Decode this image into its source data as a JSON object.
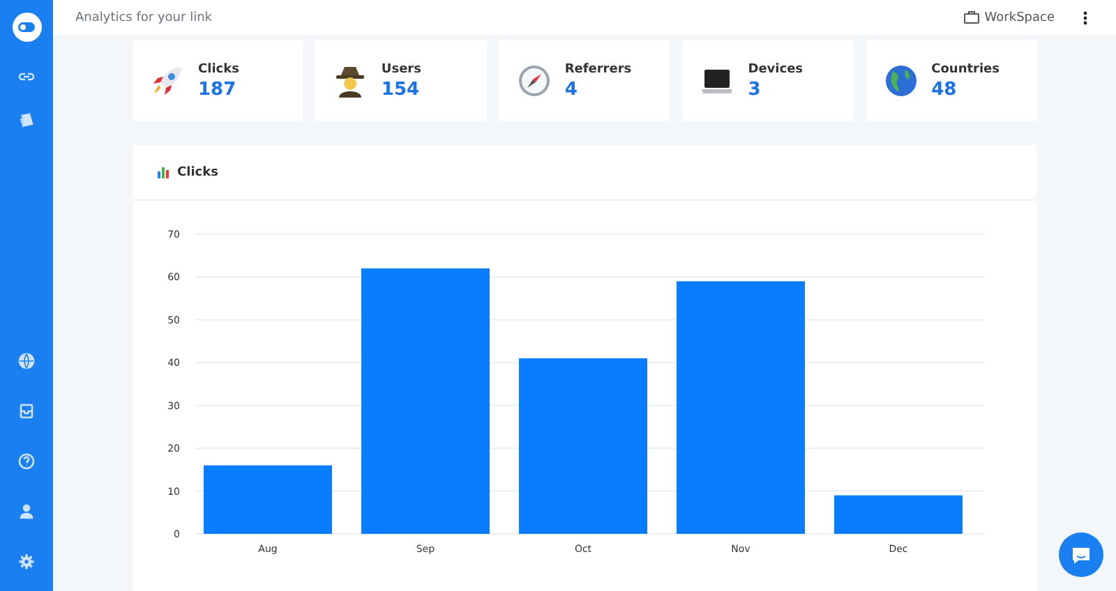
{
  "header": {
    "title": "Analytics for your link",
    "workspace": "WorkSpace"
  },
  "stats": [
    {
      "kind": "rocket",
      "label": "Clicks",
      "value": "187"
    },
    {
      "kind": "user",
      "label": "Users",
      "value": "154"
    },
    {
      "kind": "compass",
      "label": "Referrers",
      "value": "4"
    },
    {
      "kind": "laptop",
      "label": "Devices",
      "value": "3"
    },
    {
      "kind": "globe",
      "label": "Countries",
      "value": "48"
    }
  ],
  "chart_card": {
    "title": "Clicks",
    "chart_data": {
      "type": "bar",
      "categories": [
        "Aug",
        "Sep",
        "Oct",
        "Nov",
        "Dec"
      ],
      "series": [
        {
          "color": "#0a7cff",
          "values": [
            16,
            62,
            41,
            59,
            9
          ]
        }
      ],
      "ylim": [
        0,
        70
      ],
      "grid": true,
      "yticks": [
        0,
        10,
        20,
        30,
        40,
        50,
        60,
        70
      ]
    }
  }
}
